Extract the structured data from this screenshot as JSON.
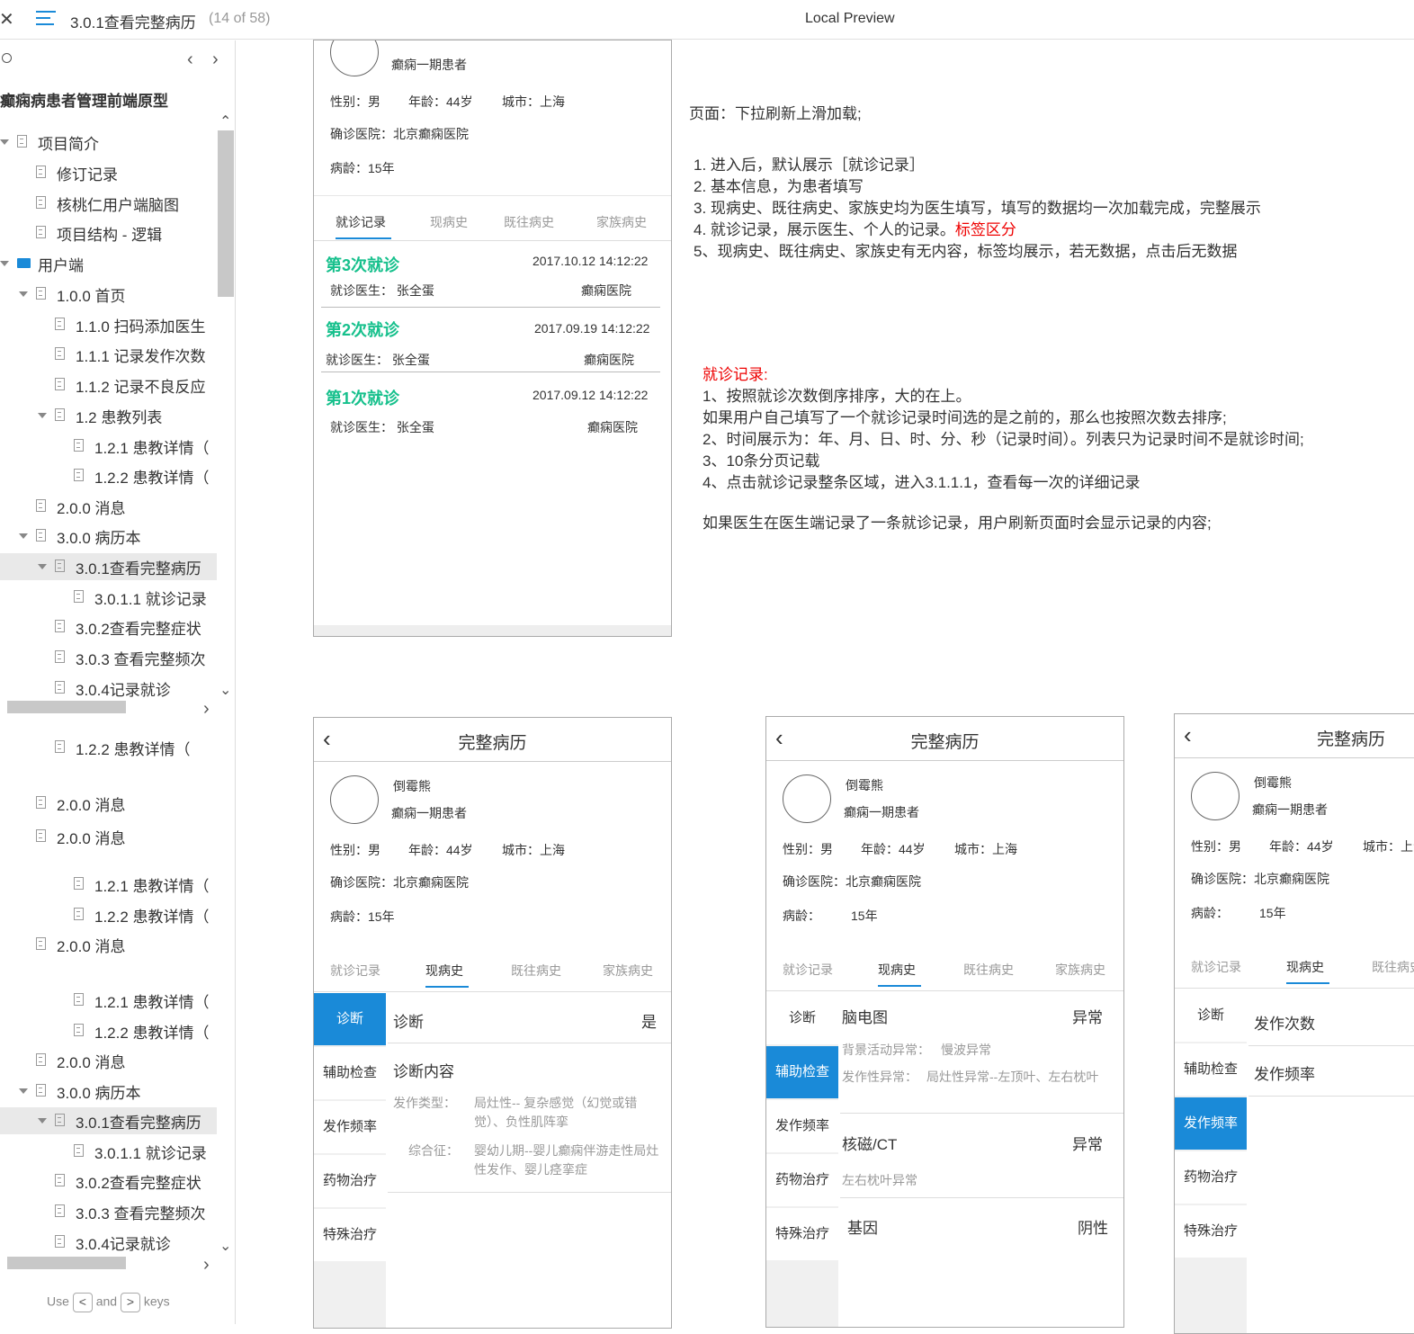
{
  "topbar": {
    "close_icon": "close-icon",
    "menu_icon": "hamburger-icon",
    "title": "3.0.1查看完整病历",
    "page_count": "(14 of 58)",
    "preview_label": "Local Preview"
  },
  "sidebar": {
    "search_icon": "search-icon",
    "project_title": "癫痫病患者管理前端原型",
    "items": [
      "项目简介",
      "修订记录",
      "核桃仁用户端脑图",
      "项目结构 - 逻辑",
      "用户端",
      "1.0.0 首页",
      "1.1.0 扫码添加医生",
      "1.1.1 记录发作次数",
      "1.1.2 记录不良反应",
      "1.2 患教列表",
      "1.2.1 患教详情（",
      "1.2.2 患教详情（",
      "2.0.0 消息",
      "3.0.0 病历本",
      "3.0.1查看完整病历",
      "3.0.1.1 就诊记录",
      "3.0.2查看完整症状",
      "3.0.3 查看完整频次",
      "3.0.4记录就诊"
    ],
    "items_lower": [
      "1.2.2 患教详情（",
      "2.0.0 消息",
      "2.0.0 消息",
      "1.2.1 患教详情（",
      "1.2.2 患教详情（",
      "2.0.0 消息",
      "1.2.1 患教详情（",
      "1.2.2 患教详情（",
      "2.0.0 消息",
      "3.0.0 病历本",
      "3.0.1查看完整病历",
      "3.0.1.1 就诊记录",
      "3.0.2查看完整症状",
      "3.0.3 查看完整频次",
      "3.0.4记录就诊"
    ],
    "footer": {
      "use": "Use",
      "and": "and",
      "keys": "keys",
      "left_key": "<",
      "right_key": ">"
    }
  },
  "phone_top": {
    "patient_type": "癫痫一期患者",
    "gender": "性别：男",
    "age": "年龄：44岁",
    "city": "城市：上海",
    "hospital": "确诊医院：北京癫痫医院",
    "duration": "病龄：15年",
    "tabs": [
      "就诊记录",
      "现病史",
      "既往病史",
      "家族病史"
    ],
    "visits": [
      {
        "title": "第3次就诊",
        "time": "2017.10.12 14:12:22",
        "doctor": "就诊医生：  张全蛋",
        "hospital": "癫痫医院"
      },
      {
        "title": "第2次就诊",
        "time": "2017.09.19 14:12:22",
        "doctor": "就诊医生：  张全蛋",
        "hospital": "癫痫医院"
      },
      {
        "title": "第1次就诊",
        "time": "2017.09.12 14:12:22",
        "doctor": "就诊医生：  张全蛋",
        "hospital": "癫痫医院"
      }
    ]
  },
  "notes": {
    "page_line": "页面：下拉刷新上滑加载;",
    "list": [
      "1. 进入后，默认展示［就诊记录］",
      "2. 基本信息，为患者填写",
      "3. 现病史、既往病史、家族史均为医生填写，填写的数据均一次加载完成，完整展示",
      "4. 就诊记录，展示医生、个人的记录。",
      "5、现病史、既往病史、家族史有无内容，标签均展示，若无数据，点击后无数据"
    ],
    "list_red": "标签区分",
    "visit_title": "就诊记录:",
    "visit_lines": [
      "1、按照就诊次数倒序排序，大的在上。",
      "如果用户自己填写了一个就诊记录时间选的是之前的，那么也按照次数去排序;",
      "2、时间展示为：年、月、日、时、分、秒（记录时间）。列表只为记录时间不是就诊时间;",
      "3、10条分页记载",
      "4、点击就诊记录整条区域，进入3.1.1.1，查看每一次的详细记录"
    ],
    "visit_extra": "如果医生在医生端记录了一条就诊记录，用户刷新页面时会显示记录的内容;"
  },
  "phone_common": {
    "nav_title": "完整病历",
    "back_icon": "back-arrow-icon",
    "name": "倒霉熊",
    "patient_type": "癫痫一期患者",
    "gender": "性别：男",
    "age": "年龄：44岁",
    "city": "城市：上海",
    "hospital": "确诊医院：北京癫痫医院",
    "duration_label": "病龄：",
    "duration_value": "15年",
    "duration_full": "病龄：15年",
    "tabs": [
      "就诊记录",
      "现病史",
      "既往病史",
      "家族病史"
    ],
    "menu": [
      "诊断",
      "辅助检查",
      "发作频率",
      "药物治疗",
      "特殊治疗"
    ]
  },
  "phone_a": {
    "row1_label": "诊断",
    "row1_value": "是",
    "row2_label": "诊断内容",
    "type_label": "发作类型：",
    "type_value": "局灶性-- 复杂感觉（幻觉或错觉）、负性肌阵挛",
    "syndrome_label": "综合征：",
    "syndrome_value": "婴幼儿期--婴儿癫痫伴游走性局灶性发作、婴儿痉挛症"
  },
  "phone_b": {
    "eeg_label": "脑电图",
    "eeg_value": "异常",
    "bg_label": "背景活动异常：",
    "bg_value": "慢波异常",
    "seizure_label": "发作性异常：",
    "seizure_value": "局灶性异常--左顶叶、左右枕叶",
    "mri_label": "核磁/CT",
    "mri_value": "异常",
    "mri_detail": "左右枕叶异常",
    "gene_label": "基因",
    "gene_value": "阴性"
  },
  "phone_c": {
    "row1": "发作次数",
    "row2": "发作频率"
  }
}
